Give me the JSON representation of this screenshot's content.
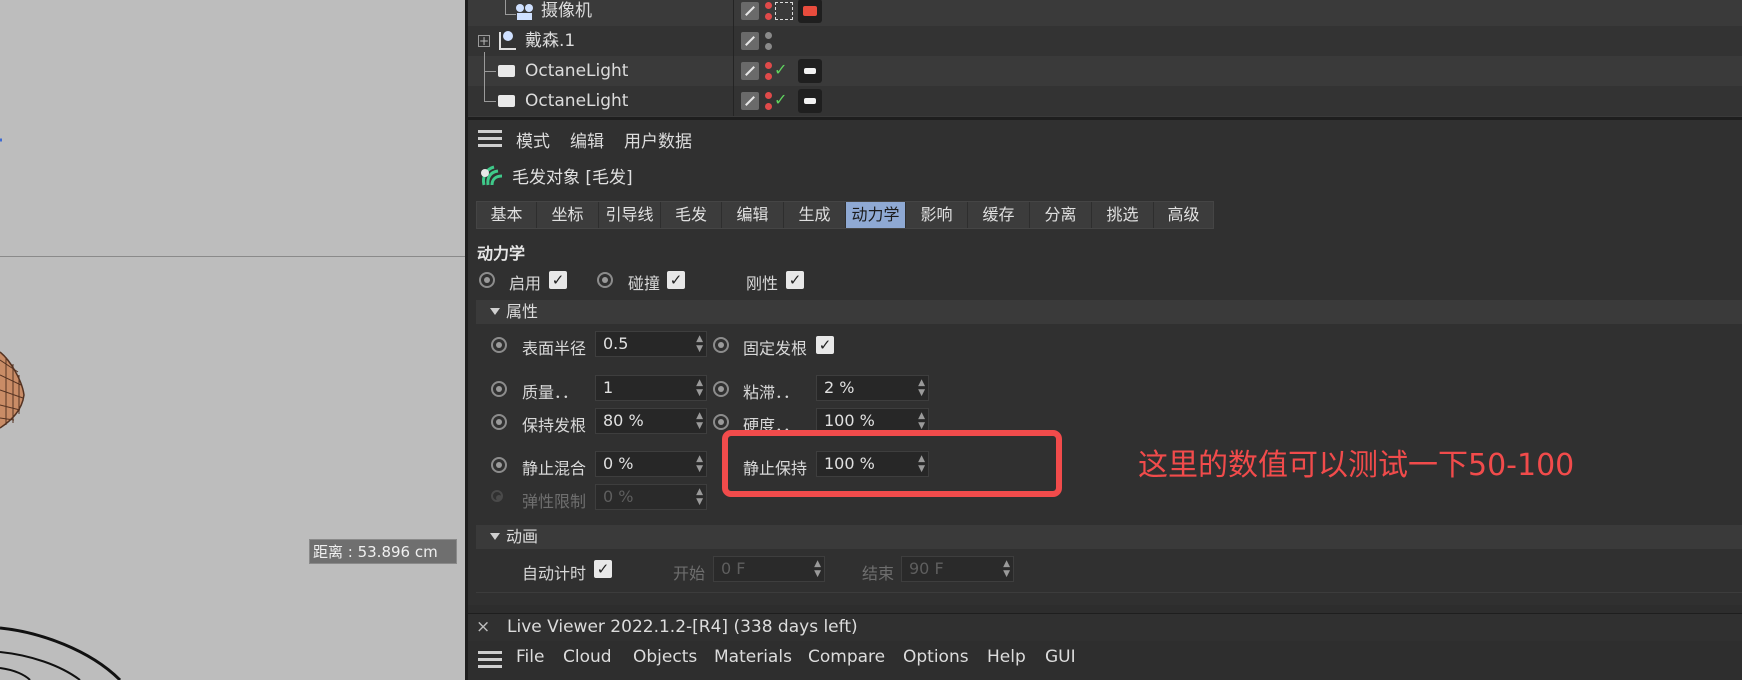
{
  "viewport": {
    "distance_label": "距离 : 53.896 cm"
  },
  "object_manager": {
    "rows": [
      {
        "name": "摄像机"
      },
      {
        "name": "戴森.1"
      },
      {
        "name": "OctaneLight"
      },
      {
        "name": "OctaneLight"
      }
    ]
  },
  "attributes": {
    "menu": [
      "模式",
      "编辑",
      "用户数据"
    ],
    "object_title": "毛发对象 [毛发]",
    "tabs": [
      "基本",
      "坐标",
      "引导线",
      "毛发",
      "编辑",
      "生成",
      "动力学",
      "影响",
      "缓存",
      "分离",
      "挑选",
      "高级"
    ],
    "active_tab": "动力学",
    "section_title": "动力学",
    "toggles": [
      {
        "label": "启用",
        "checked": true
      },
      {
        "label": "碰撞",
        "checked": true
      },
      {
        "label": "刚性",
        "checked": true
      }
    ],
    "properties_header": "属性",
    "props": {
      "surface_radius": {
        "label": "表面半径",
        "value": "0.5"
      },
      "fix_root": {
        "label": "固定发根",
        "checked": true
      },
      "mass": {
        "label": "质量．．",
        "value": "1"
      },
      "viscosity": {
        "label": "粘滞．．",
        "value": "2 %"
      },
      "hold_root": {
        "label": "保持发根",
        "value": "80 %"
      },
      "stiffness": {
        "label": "硬度．．",
        "value": "100 %"
      },
      "rest_mix": {
        "label": "静止混合",
        "value": "0 %"
      },
      "rest_hold": {
        "label": "静止保持",
        "value": "100 %"
      },
      "elastic_limit": {
        "label": "弹性限制",
        "value": "0 %"
      }
    },
    "animation_header": "动画",
    "animation": {
      "auto_time": {
        "label": "自动计时",
        "checked": true
      },
      "start": {
        "label": "开始",
        "value": "0 F"
      },
      "end": {
        "label": "结束",
        "value": "90 F"
      }
    }
  },
  "annotation": {
    "note": "这里的数值可以测试一下50-100",
    "color": "#f14b4b"
  },
  "live_viewer": {
    "title": "Live Viewer 2022.1.2-[R4] (338 days left)",
    "close": "×",
    "menu": [
      "File",
      "Cloud",
      "Objects",
      "Materials",
      "Compare",
      "Options",
      "Help",
      "GUI"
    ]
  }
}
